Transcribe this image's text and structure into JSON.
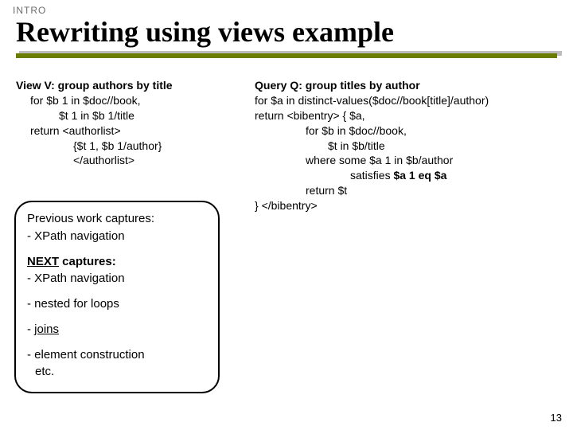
{
  "section_label": "INTRO",
  "title": "Rewriting using views example",
  "view": {
    "heading": "View V: group authors by title",
    "l1": "for $b 1 in $doc//book,",
    "l2": "$t 1  in $b 1/title",
    "l3": "return <authorlist>",
    "l4": "{$t 1, $b 1/author}",
    "l5": "</authorlist>"
  },
  "query": {
    "heading": "Query Q: group titles by author",
    "q1": "for $a in distinct-values($doc//book[title]/author)",
    "q2": "return <bibentry> { $a,",
    "q3": "for $b in $doc//book,",
    "q4": "$t  in $b/title",
    "q5": "where some $a 1 in $b/author",
    "q6a": "satisfies ",
    "q6b": "$a 1 eq $a",
    "q7": "return $t",
    "q8": "} </bibentry>"
  },
  "box": {
    "prev_lead": "Previous work captures:",
    "prev_item1": "- XPath navigation",
    "next_lead_u": "NEXT",
    "next_lead_rest": " captures:",
    "next_item1": "- XPath navigation",
    "nested": "- nested for loops",
    "joins_dash": "- ",
    "joins": "joins",
    "elem1": "- element construction",
    "elem2": "etc."
  },
  "page_number": "13"
}
